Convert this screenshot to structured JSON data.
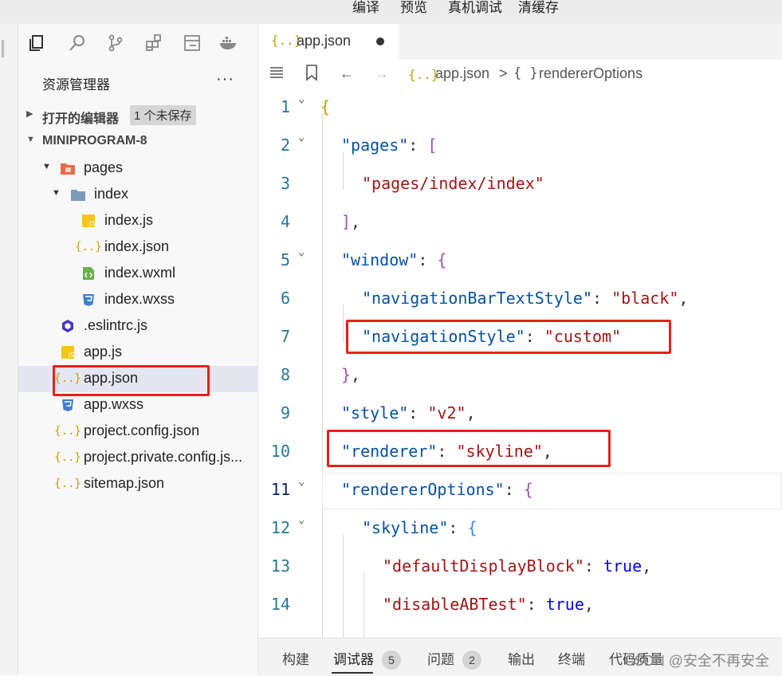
{
  "top_menu": [
    "编译",
    "预览",
    "真机调试",
    "清缓存"
  ],
  "sidebar": {
    "activity_icons": [
      "files-icon",
      "search-icon",
      "source-control-icon",
      "extensions-icon",
      "layout-icon",
      "docker-icon"
    ],
    "explorer_title": "资源管理器",
    "more": "···",
    "open_editors": {
      "label": "打开的编辑器",
      "badge": "1 个未保存"
    },
    "project": {
      "label": "MINIPROGRAM-8"
    },
    "tree": [
      {
        "label": "pages",
        "kind": "folder-red",
        "expanded": true,
        "depth": 1
      },
      {
        "label": "index",
        "kind": "folder",
        "expanded": true,
        "depth": 2
      },
      {
        "label": "index.js",
        "kind": "js",
        "depth": 3
      },
      {
        "label": "index.json",
        "kind": "json",
        "depth": 3
      },
      {
        "label": "index.wxml",
        "kind": "wxml",
        "depth": 3
      },
      {
        "label": "index.wxss",
        "kind": "wxss",
        "depth": 3
      },
      {
        "label": ".eslintrc.js",
        "kind": "eslint",
        "depth": 1
      },
      {
        "label": "app.js",
        "kind": "js",
        "depth": 1
      },
      {
        "label": "app.json",
        "kind": "json",
        "depth": 1,
        "selected": true
      },
      {
        "label": "app.wxss",
        "kind": "wxss",
        "depth": 1
      },
      {
        "label": "project.config.json",
        "kind": "json",
        "depth": 1
      },
      {
        "label": "project.private.config.js...",
        "kind": "json",
        "depth": 1
      },
      {
        "label": "sitemap.json",
        "kind": "json",
        "depth": 1
      }
    ]
  },
  "editor": {
    "tab": {
      "icon": "{..}",
      "name": "app.json",
      "unsaved": true
    },
    "breadcrumb": {
      "file_icon": "{..}",
      "file": "app.json",
      "sep": ">",
      "obj_icon": "{ }",
      "symbol": "rendererOptions"
    },
    "lines": [
      {
        "n": "1",
        "fold": true,
        "indent": 0,
        "parts": [
          [
            "br1",
            "{"
          ]
        ]
      },
      {
        "n": "2",
        "fold": true,
        "indent": 1,
        "parts": [
          [
            "k",
            "\"pages\""
          ],
          [
            "p",
            ": "
          ],
          [
            "br2",
            "["
          ]
        ]
      },
      {
        "n": "3",
        "indent": 2,
        "parts": [
          [
            "s",
            "\"pages/index/index\""
          ]
        ]
      },
      {
        "n": "4",
        "indent": 1,
        "parts": [
          [
            "br2",
            "]"
          ],
          [
            "p",
            ","
          ]
        ]
      },
      {
        "n": "5",
        "fold": true,
        "indent": 1,
        "parts": [
          [
            "k",
            "\"window\""
          ],
          [
            "p",
            ": "
          ],
          [
            "br2",
            "{"
          ]
        ]
      },
      {
        "n": "6",
        "indent": 2,
        "parts": [
          [
            "k",
            "\"navigationBarTextStyle\""
          ],
          [
            "p",
            ": "
          ],
          [
            "s",
            "\"black\""
          ],
          [
            "p",
            ","
          ]
        ]
      },
      {
        "n": "7",
        "indent": 2,
        "parts": [
          [
            "k",
            "\"navigationStyle\""
          ],
          [
            "p",
            ": "
          ],
          [
            "s",
            "\"custom\""
          ]
        ]
      },
      {
        "n": "8",
        "indent": 1,
        "parts": [
          [
            "br2",
            "}"
          ],
          [
            "p",
            ","
          ]
        ]
      },
      {
        "n": "9",
        "indent": 1,
        "parts": [
          [
            "k",
            "\"style\""
          ],
          [
            "p",
            ": "
          ],
          [
            "s",
            "\"v2\""
          ],
          [
            "p",
            ","
          ]
        ]
      },
      {
        "n": "10",
        "indent": 1,
        "parts": [
          [
            "k",
            "\"renderer\""
          ],
          [
            "p",
            ": "
          ],
          [
            "s",
            "\"skyline\""
          ],
          [
            "p",
            ","
          ]
        ]
      },
      {
        "n": "11",
        "fold": true,
        "indent": 1,
        "active": true,
        "parts": [
          [
            "k",
            "\"rendererOptions\""
          ],
          [
            "p",
            ": "
          ],
          [
            "br2",
            "{"
          ]
        ]
      },
      {
        "n": "12",
        "fold": true,
        "indent": 2,
        "parts": [
          [
            "k",
            "\"skyline\""
          ],
          [
            "p",
            ": "
          ],
          [
            "br3",
            "{"
          ]
        ]
      },
      {
        "n": "13",
        "indent": 3,
        "parts": [
          [
            "s",
            "\"defaultDisplayBlock\""
          ],
          [
            "p",
            ": "
          ],
          [
            "bl",
            "true"
          ],
          [
            "p",
            ","
          ]
        ]
      },
      {
        "n": "14",
        "indent": 3,
        "parts": [
          [
            "s",
            "\"disableABTest\""
          ],
          [
            "p",
            ": "
          ],
          [
            "bl",
            "true"
          ],
          [
            "p",
            ","
          ]
        ]
      }
    ]
  },
  "bottom_tabs": [
    {
      "label": "构建"
    },
    {
      "label": "调试器",
      "count": "5",
      "active": true
    },
    {
      "label": "问题",
      "count": "2"
    },
    {
      "label": "输出"
    },
    {
      "label": "终端"
    },
    {
      "label": "代码质量"
    }
  ],
  "watermark": "CSDN @安全不再安全"
}
